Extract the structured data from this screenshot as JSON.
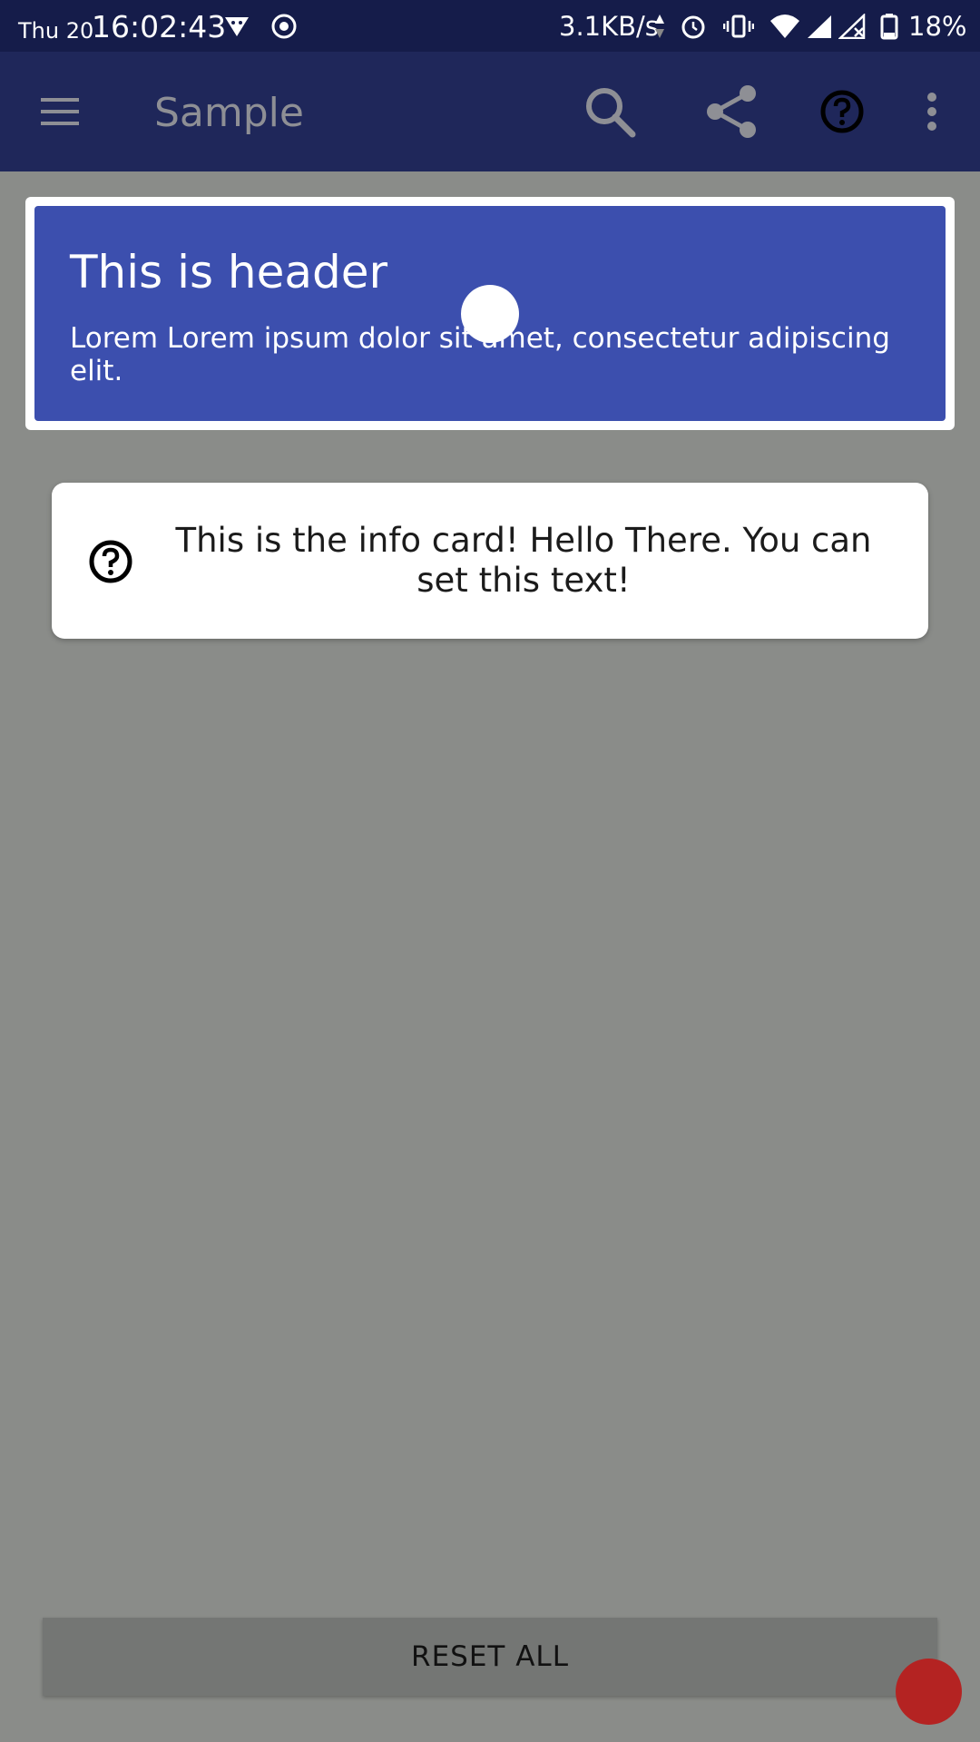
{
  "status_bar": {
    "day": "Thu 20",
    "time": "16:02:43",
    "network_speed": "3.1KB/s",
    "battery": "18%",
    "icons": [
      "vpn-icon",
      "record-icon",
      "data-arrows-icon",
      "alarm-icon",
      "vibrate-icon",
      "wifi-icon",
      "signal-icon",
      "signal-no-data-icon",
      "battery-icon"
    ]
  },
  "app_bar": {
    "title": "Sample",
    "icons": [
      "menu-icon",
      "search-icon",
      "share-icon",
      "help-icon",
      "more-vert-icon"
    ]
  },
  "header_card": {
    "title": "This is header",
    "body": "Lorem Lorem ipsum dolor sit amet, consectetur adipiscing elit."
  },
  "info_card": {
    "icon": "help-circle-icon",
    "text": "This is the info card! Hello There. You can set this text!"
  },
  "reset_button": {
    "label": "RESET ALL"
  },
  "colors": {
    "status_bar": "#151c4a",
    "app_bar": "#1f275a",
    "header_card": "#3c4fae",
    "background_scrim": "#8a8c89",
    "reset_button": "#747674",
    "red_indicator": "#b42322"
  }
}
